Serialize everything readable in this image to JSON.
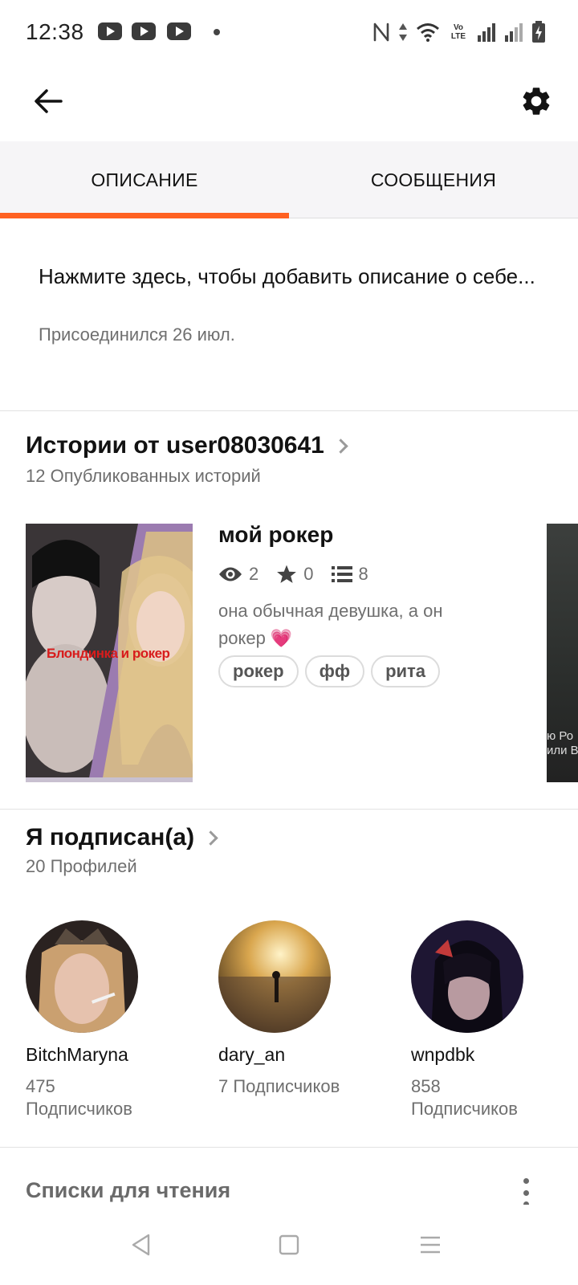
{
  "status_bar": {
    "time": "12:38",
    "icons": [
      "youtube-icon",
      "youtube-icon",
      "youtube-icon",
      "notification-dot",
      "nfc-icon",
      "data-arrows-icon",
      "wifi-icon",
      "volte-icon",
      "signal-icon",
      "signal-icon",
      "battery-charging-icon"
    ],
    "volte_label": "Vo LTE"
  },
  "toolbar": {
    "back_icon": "arrow-left-icon",
    "settings_icon": "gear-icon"
  },
  "tabs": [
    {
      "label": "ОПИСАНИЕ",
      "selected": true
    },
    {
      "label": "СООБЩЕНИЯ",
      "selected": false
    }
  ],
  "accent_color": "#ff6122",
  "about": {
    "text": "Нажмите здесь, чтобы добавить описание о себе...",
    "joined": "Присоединился 26 июл."
  },
  "stories": {
    "title": "Истории от user08030641",
    "subtitle": "12 Опубликованных историй",
    "items": [
      {
        "cover_text": "Блондинка и рокер",
        "title": "мой рокер",
        "views": "2",
        "votes": "0",
        "parts": "8",
        "description": "она обычная девушка, а он рокер 💗",
        "tags": [
          "рокер",
          "фф",
          "рита"
        ]
      }
    ],
    "next_cover_text": "ю Ро\nили В"
  },
  "following": {
    "title": "Я подписан(а)",
    "subtitle": "20 Профилей",
    "profiles": [
      {
        "name": "BitchMaryna",
        "followers": "475\nПодписчиков"
      },
      {
        "name": "dary_an",
        "followers": "7 Подписчиков"
      },
      {
        "name": "wnpdbk",
        "followers": "858\nПодписчиков"
      }
    ]
  },
  "reading_lists": {
    "title": "Списки для чтения"
  },
  "navbar": {
    "icons": [
      "back-triangle-icon",
      "home-square-icon",
      "recents-menu-icon"
    ]
  }
}
